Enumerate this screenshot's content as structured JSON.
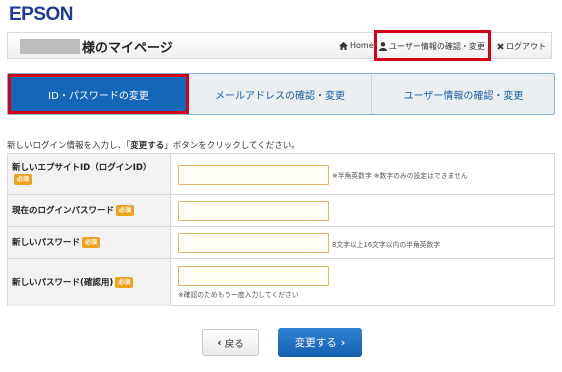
{
  "brand": {
    "logo": "EPSON"
  },
  "header": {
    "page_title": "様のマイページ",
    "links": {
      "home": "Home",
      "user_info": "ユーザー情報の確認・変更",
      "logout": "ログアウト"
    }
  },
  "tabs": [
    {
      "label": "ID・パスワードの変更",
      "active": true
    },
    {
      "label": "メールアドレスの確認・変更",
      "active": false
    },
    {
      "label": "ユーザー情報の確認・変更",
      "active": false
    }
  ],
  "instructions": {
    "before": "新しいログイン情報を入力し、「",
    "bold": "変更する",
    "after": "」ボタンをクリックしてください。"
  },
  "form": {
    "required_badge": "必須",
    "fields": [
      {
        "label": "新しいエプサイトID（ログインID）",
        "value": "",
        "note": "※半角英数字 ※数字のみの設定はできません"
      },
      {
        "label": "現在のログインパスワード",
        "value": "",
        "note": ""
      },
      {
        "label": "新しいパスワード",
        "value": "",
        "note": "8文字以上16文字以内の半角英数字"
      },
      {
        "label": "新しいパスワード(確認用)",
        "value": "",
        "note": "※確認のためもう一度入力してください"
      }
    ]
  },
  "buttons": {
    "back": "戻る",
    "submit": "変更する"
  },
  "colors": {
    "accent": "#1466b8",
    "highlight": "#d4001a",
    "required": "#f0a11e",
    "logo": "#1e3c96"
  }
}
